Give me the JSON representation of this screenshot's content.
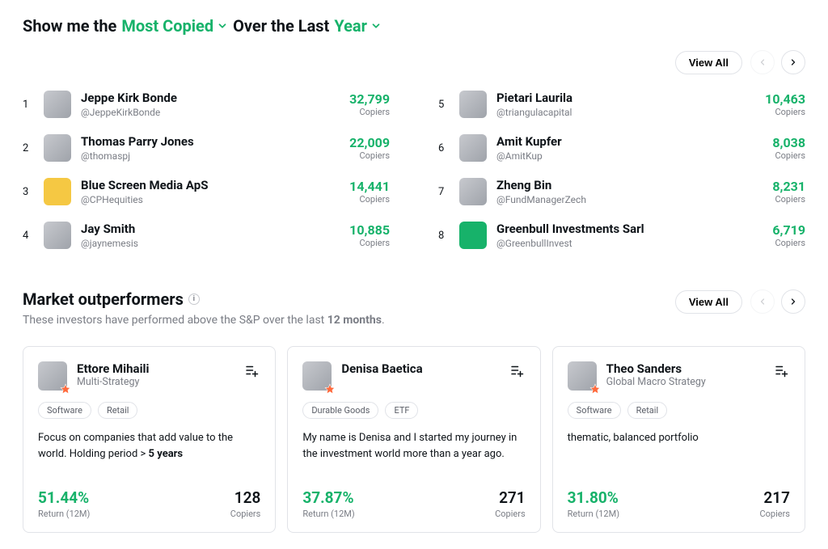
{
  "filter": {
    "prefix1": "Show me the",
    "metric": "Most Copied",
    "prefix2": "Over the Last",
    "period": "Year"
  },
  "controls": {
    "viewAll": "View All"
  },
  "investors": {
    "col1": [
      {
        "rank": "1",
        "name": "Jeppe Kirk Bonde",
        "handle": "@JeppeKirkBonde",
        "value": "32,799",
        "metric": "Copiers"
      },
      {
        "rank": "2",
        "name": "Thomas Parry Jones",
        "handle": "@thomaspj",
        "value": "22,009",
        "metric": "Copiers"
      },
      {
        "rank": "3",
        "name": "Blue Screen Media ApS",
        "handle": "@CPHequities",
        "value": "14,441",
        "metric": "Copiers"
      },
      {
        "rank": "4",
        "name": "Jay Smith",
        "handle": "@jaynemesis",
        "value": "10,885",
        "metric": "Copiers"
      }
    ],
    "col2": [
      {
        "rank": "5",
        "name": "Pietari Laurila",
        "handle": "@triangulacapital",
        "value": "10,463",
        "metric": "Copiers"
      },
      {
        "rank": "6",
        "name": "Amit Kupfer",
        "handle": "@AmitKup",
        "value": "8,038",
        "metric": "Copiers"
      },
      {
        "rank": "7",
        "name": "Zheng Bin",
        "handle": "@FundManagerZech",
        "value": "8,231",
        "metric": "Copiers"
      },
      {
        "rank": "8",
        "name": "Greenbull Investments Sarl",
        "handle": "@GreenbullInvest",
        "value": "6,719",
        "metric": "Copiers"
      }
    ]
  },
  "outperformers": {
    "title": "Market outperformers",
    "subtitlePrefix": "These investors have performed above the S&P over the last ",
    "subtitleBold": "12 months",
    "subtitleSuffix": ".",
    "cards": [
      {
        "name": "Ettore Mihaili",
        "strategy": "Multi-Strategy",
        "tags": [
          "Software",
          "Retail"
        ],
        "descPrefix": "Focus on companies that add value to the world. Holding period > ",
        "descBold": "5 years",
        "descSuffix": "",
        "return": "51.44%",
        "returnLabel": "Return (12M)",
        "copiers": "128",
        "copiersLabel": "Copiers"
      },
      {
        "name": "Denisa Baetica",
        "strategy": "",
        "tags": [
          "Durable Goods",
          "ETF"
        ],
        "descPrefix": "My name is Denisa and I started my journey in the investment world more than a year ago.",
        "descBold": "",
        "descSuffix": "",
        "return": "37.87%",
        "returnLabel": "Return (12M)",
        "copiers": "271",
        "copiersLabel": "Copiers"
      },
      {
        "name": "Theo Sanders",
        "strategy": "Global Macro Strategy",
        "tags": [
          "Software",
          "Retail"
        ],
        "descPrefix": "thematic, balanced portfolio",
        "descBold": "",
        "descSuffix": "",
        "return": "31.80%",
        "returnLabel": "Return (12M)",
        "copiers": "217",
        "copiersLabel": "Copiers"
      }
    ]
  }
}
